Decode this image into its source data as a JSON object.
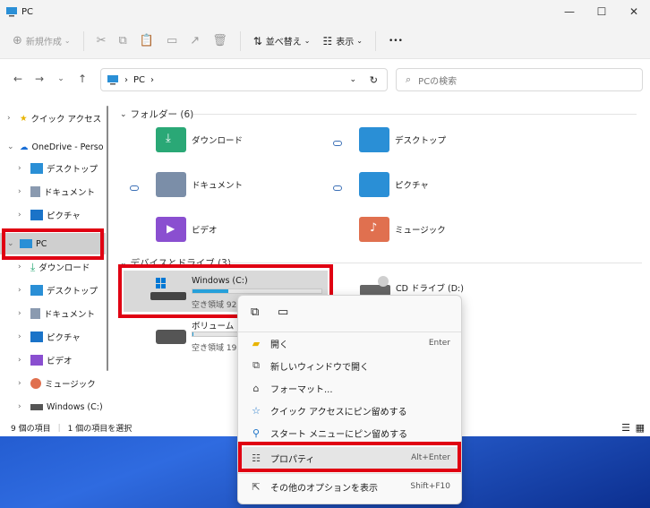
{
  "window": {
    "title": "PC"
  },
  "toolbar": {
    "new_label": "新規作成",
    "sort_label": "並べ替え",
    "view_label": "表示",
    "more_label": "•••"
  },
  "address": {
    "location": "PC",
    "refresh_icon": "refresh-icon"
  },
  "search": {
    "placeholder": "PCの検索"
  },
  "sidebar": {
    "items": [
      {
        "label": "クイック アクセス",
        "icon": "star-icon"
      },
      {
        "label": "OneDrive - Perso",
        "icon": "cloud-icon"
      },
      {
        "label": "デスクトップ",
        "icon": "desktop-icon"
      },
      {
        "label": "ドキュメント",
        "icon": "document-icon"
      },
      {
        "label": "ピクチャ",
        "icon": "picture-icon"
      },
      {
        "label": "PC",
        "icon": "pc-icon"
      },
      {
        "label": "ダウンロード",
        "icon": "download-icon"
      },
      {
        "label": "デスクトップ",
        "icon": "desktop-icon"
      },
      {
        "label": "ドキュメント",
        "icon": "document-icon"
      },
      {
        "label": "ピクチャ",
        "icon": "picture-icon"
      },
      {
        "label": "ビデオ",
        "icon": "video-icon"
      },
      {
        "label": "ミュージック",
        "icon": "music-icon"
      },
      {
        "label": "Windows (C:)",
        "icon": "drive-icon"
      }
    ]
  },
  "main": {
    "folders_header": "フォルダー (6)",
    "folders": [
      {
        "label": "ダウンロード",
        "color": "#2aa876"
      },
      {
        "label": "デスクトップ",
        "color": "#2a8fd6"
      },
      {
        "label": "ドキュメント",
        "color": "#7b8ea8"
      },
      {
        "label": "ピクチャ",
        "color": "#2a8fd6"
      },
      {
        "label": "ビデオ",
        "color": "#8a4fd0"
      },
      {
        "label": "ミュージック",
        "color": "#e0704f"
      }
    ],
    "drives_header": "デバイスとドライブ (3)",
    "drives": [
      {
        "label": "Windows (C:)",
        "free": "空き領域 92.",
        "used_fraction": 0.28
      },
      {
        "label": "ボリューム (E:)",
        "free": "空き領域 19.",
        "used_fraction": 0.02
      },
      {
        "label": "CD ドライブ (D:)"
      }
    ]
  },
  "status": {
    "count": "9 個の項目",
    "selected": "1 個の項目を選択"
  },
  "context_menu": {
    "items": [
      {
        "label": "開く",
        "shortcut": "Enter",
        "icon": "folder-open-icon"
      },
      {
        "label": "新しいウィンドウで開く",
        "shortcut": "",
        "icon": "new-window-icon"
      },
      {
        "label": "フォーマット...",
        "shortcut": "",
        "icon": "format-icon"
      },
      {
        "label": "クイック アクセスにピン留めする",
        "shortcut": "",
        "icon": "star-icon"
      },
      {
        "label": "スタート メニューにピン留めする",
        "shortcut": "",
        "icon": "pin-icon"
      },
      {
        "label": "プロパティ",
        "shortcut": "Alt+Enter",
        "icon": "properties-icon"
      },
      {
        "label": "その他のオプションを表示",
        "shortcut": "Shift+F10",
        "icon": "more-options-icon"
      }
    ]
  },
  "colors": {
    "highlight_red": "#e00012",
    "accent_blue": "#26a0da"
  }
}
